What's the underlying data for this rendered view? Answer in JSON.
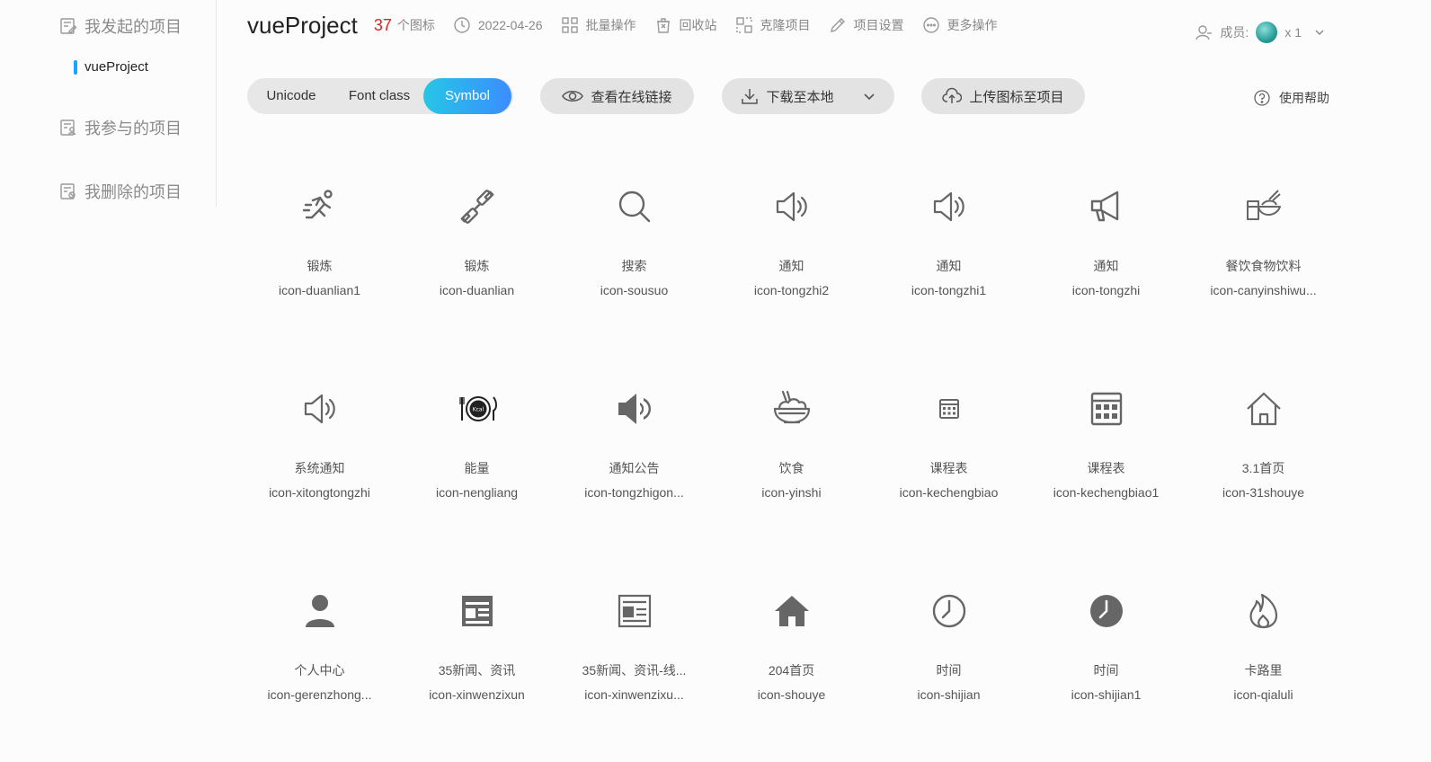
{
  "sidebar": {
    "my_projects": "我发起的项目",
    "active_project": "vueProject",
    "joined_projects": "我参与的项目",
    "deleted_projects": "我删除的项目"
  },
  "header": {
    "project_title": "vueProject",
    "icon_count": "37",
    "icon_count_label": "个图标",
    "date": "2022-04-26",
    "batch_ops": "批量操作",
    "recycle_bin": "回收站",
    "clone_project": "克隆项目",
    "project_settings": "项目设置",
    "more_ops": "更多操作",
    "members_label": "成员:",
    "members_count": "x 1"
  },
  "toolbar": {
    "tabs": [
      "Unicode",
      "Font class",
      "Symbol"
    ],
    "active_tab": "Symbol",
    "view_online": "查看在线链接",
    "download": "下载至本地",
    "upload": "上传图标至项目",
    "help": "使用帮助"
  },
  "icons": [
    {
      "cn": "锻炼",
      "en": "icon-duanlian1",
      "glyph": "running-icon"
    },
    {
      "cn": "锻炼",
      "en": "icon-duanlian",
      "glyph": "dumbbell-icon"
    },
    {
      "cn": "搜索",
      "en": "icon-sousuo",
      "glyph": "search-icon"
    },
    {
      "cn": "通知",
      "en": "icon-tongzhi2",
      "glyph": "speaker-outline-icon"
    },
    {
      "cn": "通知",
      "en": "icon-tongzhi1",
      "glyph": "speaker-outline-icon"
    },
    {
      "cn": "通知",
      "en": "icon-tongzhi",
      "glyph": "megaphone-icon"
    },
    {
      "cn": "餐饮食物饮料",
      "en": "icon-canyinshiwu...",
      "glyph": "food-drink-icon"
    },
    {
      "cn": "系统通知",
      "en": "icon-xitongtongzhi",
      "glyph": "speaker-outline-icon"
    },
    {
      "cn": "能量",
      "en": "icon-nengliang",
      "glyph": "kcal-plate-icon"
    },
    {
      "cn": "通知公告",
      "en": "icon-tongzhigon...",
      "glyph": "speaker-filled-icon"
    },
    {
      "cn": "饮食",
      "en": "icon-yinshi",
      "glyph": "rice-bowl-icon"
    },
    {
      "cn": "课程表",
      "en": "icon-kechengbiao",
      "glyph": "calendar-small-icon"
    },
    {
      "cn": "课程表",
      "en": "icon-kechengbiao1",
      "glyph": "calendar-icon"
    },
    {
      "cn": "3.1首页",
      "en": "icon-31shouye",
      "glyph": "home-outline-icon"
    },
    {
      "cn": "个人中心",
      "en": "icon-gerenzhong...",
      "glyph": "person-icon"
    },
    {
      "cn": "35新闻、资讯",
      "en": "icon-xinwenzixun",
      "glyph": "news-filled-icon"
    },
    {
      "cn": "35新闻、资讯-线...",
      "en": "icon-xinwenzixu...",
      "glyph": "news-outline-icon"
    },
    {
      "cn": "204首页",
      "en": "icon-shouye",
      "glyph": "home-filled-icon"
    },
    {
      "cn": "时间",
      "en": "icon-shijian",
      "glyph": "clock-outline-icon"
    },
    {
      "cn": "时间",
      "en": "icon-shijian1",
      "glyph": "clock-filled-icon"
    },
    {
      "cn": "卡路里",
      "en": "icon-qialuli",
      "glyph": "flame-icon"
    }
  ],
  "colors": {
    "accent_start": "#26c6e6",
    "accent_end": "#3b8dff",
    "count_red": "#e02020",
    "icon_gray": "#666666"
  }
}
